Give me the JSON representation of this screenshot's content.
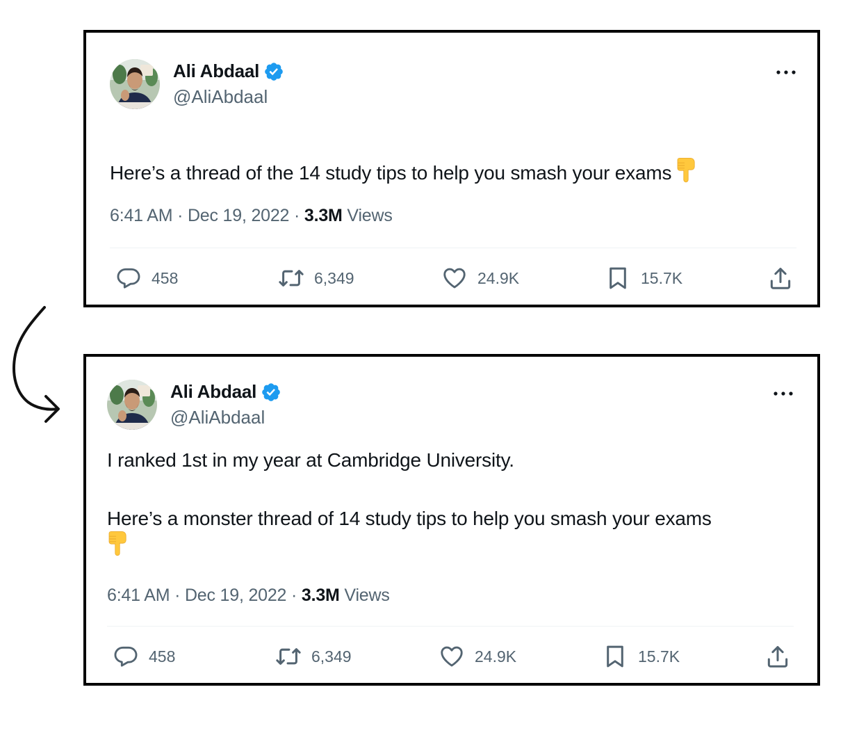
{
  "original_tweet": {
    "author_name": "Ali Abdaal",
    "handle": "@AliAbdaal",
    "text": "Here’s a thread of the 14 study tips to help you smash your exams",
    "emoji": "backhand-index-pointing-down",
    "time": "6:41 AM · Dec 19, 2022 · ",
    "views_count": "3.3M",
    "views_label": " Views",
    "stats": {
      "replies": "458",
      "retweets": "6,349",
      "likes": "24.9K",
      "bookmarks": "15.7K"
    }
  },
  "revised_tweet": {
    "author_name": "Ali Abdaal",
    "handle": "@AliAbdaal",
    "text_line1": "I ranked 1st in my year at Cambridge University.",
    "text_line2": "Here’s a monster thread of 14 study tips to help you smash your exams",
    "emoji": "backhand-index-pointing-down",
    "time": "6:41 AM · Dec 19, 2022 · ",
    "views_count": "3.3M",
    "views_label": " Views",
    "stats": {
      "replies": "458",
      "retweets": "6,349",
      "likes": "24.9K",
      "bookmarks": "15.7K"
    }
  },
  "colors": {
    "text_primary": "#0f1419",
    "text_secondary": "#536471",
    "verified_blue": "#1d9bf0",
    "card_border": "#000000",
    "emoji_yellow": "#ffc83d"
  }
}
